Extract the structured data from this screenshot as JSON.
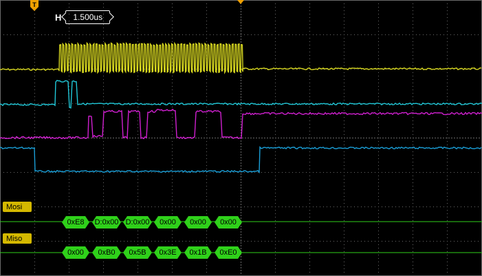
{
  "timebase": {
    "label": "H",
    "value": "1.500us"
  },
  "trigger_marker": {
    "label": "T",
    "color": "#f0a000"
  },
  "center_marker": {
    "color": "#f0a000"
  },
  "colors": {
    "ch1": "#d8d820",
    "ch2": "#20c8d8",
    "ch3": "#d020d0",
    "ch4": "#1a9fd8",
    "bus": "#2fd11a",
    "tag": "#d4b800",
    "grid": "#6a6a6a"
  },
  "buses": [
    {
      "name": "Mosi",
      "frames": [
        "0xE8",
        "D:0x00",
        "D:0x00",
        "0x00",
        "0x00",
        "0x00"
      ]
    },
    {
      "name": "Miso",
      "frames": [
        "0x00",
        "0xB0",
        "0x5B",
        "0x3E",
        "0x1B",
        "0xE0"
      ]
    }
  ]
}
